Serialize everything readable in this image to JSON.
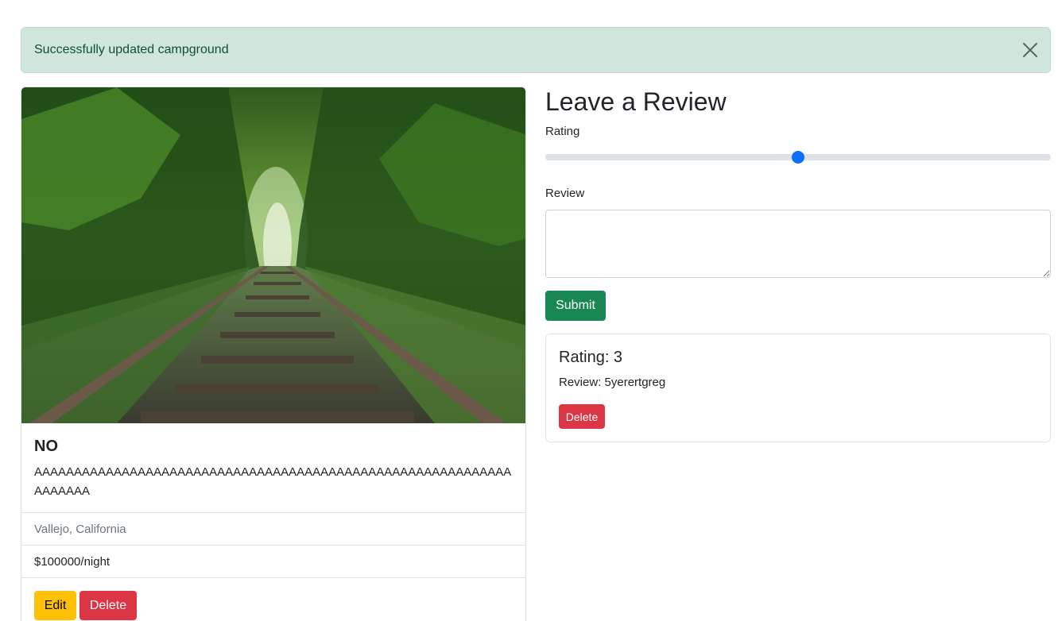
{
  "alert": {
    "message": "Successfully updated campground",
    "close_icon": "close-icon",
    "color": "#0f5132",
    "background": "#d1e7dd"
  },
  "campground": {
    "title": "NO",
    "description": "AAAAAAAAAAAAAAAAAAAAAAAAAAAAAAAAAAAAAAAAAAAAAAAAAAAAAAAAAAAAAAAAAAA",
    "location": "Vallejo, California",
    "price": "$100000/night",
    "edit_label": "Edit",
    "delete_label": "Delete"
  },
  "review_form": {
    "title": "Leave a Review",
    "rating_label": "Rating",
    "rating_min": 1,
    "rating_max": 5,
    "rating_value": 3,
    "review_label": "Review",
    "review_value": "",
    "submit_label": "Submit"
  },
  "reviews": [
    {
      "heading": "Rating: 3",
      "body": "Review: 5yerertgreg",
      "delete_label": "Delete"
    }
  ],
  "colors": {
    "primary": "#0d6efd",
    "success": "#198754",
    "danger": "#dc3545",
    "warning": "#ffc107"
  }
}
